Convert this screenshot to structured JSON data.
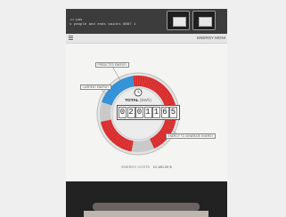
{
  "ticker": {
    "line1": "Tu pas",
    "line2": "s people and ends saints 8887 1"
  },
  "header": {
    "title": "ENERGY MONI"
  },
  "gauge": {
    "segments_total_deg": 360,
    "segments": [
      {
        "name": "blue-segment",
        "color": "#2f8fd6",
        "start_deg": -72,
        "end_deg": -8
      },
      {
        "name": "red-segment-right",
        "color": "#d92b2b",
        "start_deg": -8,
        "end_deg": 155
      },
      {
        "name": "red-segment-left",
        "color": "#d92b2b",
        "start_deg": 190,
        "end_deg": 258
      }
    ],
    "labels": {
      "top": "PREDICTED ENERGY",
      "left": "CURRENT ENERGY",
      "right": "ENERGY TO GENERATE ENERGY"
    },
    "total_title": "TOTAL",
    "total_sub": "(kWh)",
    "digits": [
      "0",
      "2",
      "0",
      "1",
      "1",
      "6",
      "5"
    ]
  },
  "footer": {
    "label": "ENERGY COSTS",
    "value": "10,180.29 $"
  },
  "colors": {
    "accent_red": "#d92b2b",
    "accent_blue": "#2f8fd6",
    "ring_gray": "#c9c9c9"
  }
}
